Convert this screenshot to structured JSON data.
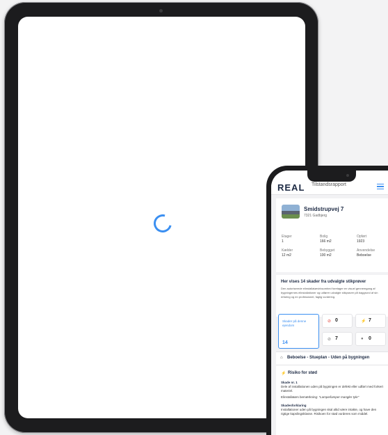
{
  "phone": {
    "logo": "REAL",
    "top_title": "Tilstandsrapport",
    "address": {
      "street": "Smidstrupvej 7",
      "city": "7321 Gadbjerg"
    },
    "facts": [
      {
        "label": "Etager",
        "value": "1"
      },
      {
        "label": "Bolig",
        "value": "166 m2"
      },
      {
        "label": "Opført",
        "value": "1923"
      },
      {
        "label": "Kælder",
        "value": "12 m2"
      },
      {
        "label": "Bebygget",
        "value": "100 m2"
      },
      {
        "label": "Anvendelse",
        "value": "Beboelse"
      }
    ],
    "description": {
      "title": "Her vises 14 skader fra udvalgte stikprøver",
      "text": "Den autoriserede elinstallatørvirksomhed foretager en visuel gennemgang af bygningernes elinstallationer og udfører udvalgte stikprøver på baggrund af sin erfaring og en professionel, faglig vurdering."
    },
    "tiles": {
      "main_label": "Skader på denne ejendom",
      "main_count": "14",
      "red_count": "0",
      "yellow_count": "7",
      "none_count": "7",
      "grey_count": "0"
    },
    "section_title": "Beboelse - Stueplan - Uden på bygningen",
    "risk_title": "Risiko for stød",
    "damage_no": "Skade nr. 1",
    "damage_text": "Dele af installationen uden på bygningen er defekt eller udført med forkert materiel.",
    "remark_label": "Elinstallatørs bemærkning:",
    "remark_text": "\"Lampe/lamper mangler tyle\"",
    "explanation_title": "Skadesforklaring",
    "explanation_text": "Installationer uden på bygningen skal altid være intakte, og have den rigtige kapslingsklasse. Risikoen for stød vurderes som middel."
  },
  "colors": {
    "accent": "#3b8ff1",
    "navy": "#1d2a44",
    "warning": "#f2b01e",
    "danger": "#e2453c"
  }
}
